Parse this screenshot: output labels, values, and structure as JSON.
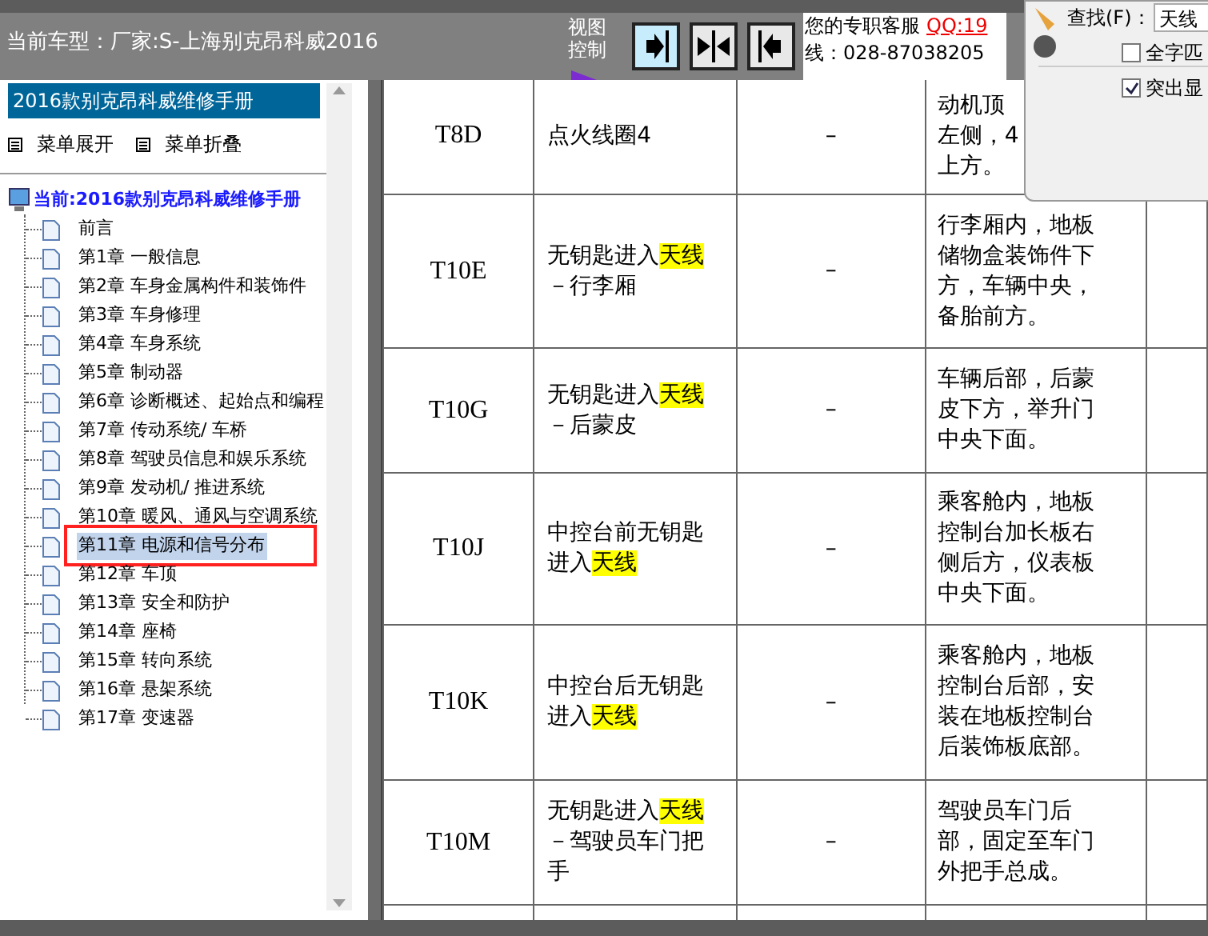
{
  "header": {
    "title": "当前车型：厂家:S-上海别克昂科威2016",
    "view_label": "视图控制",
    "view_buttons": [
      {
        "kind": "right",
        "selected": true
      },
      {
        "kind": "both",
        "selected": false
      },
      {
        "kind": "left",
        "selected": false
      }
    ],
    "service": "您的专职客服",
    "qq": "QQ:19",
    "phone": "线：028-87038205"
  },
  "find_dialog": {
    "label": "查找(F)：",
    "value": "天线",
    "options": [
      {
        "label": "全字匹",
        "checked": false
      },
      {
        "label": "突出显",
        "checked": true
      }
    ]
  },
  "sidebar": {
    "title": "2016款别克昂科威维修手册",
    "actions": [
      "菜单展开",
      "菜单折叠"
    ],
    "root": "当前:2016款别克昂科威维修手册",
    "items": [
      {
        "label": "前言",
        "selected": false,
        "marked": false
      },
      {
        "label": "第1章 一般信息",
        "selected": false,
        "marked": false
      },
      {
        "label": "第2章 车身金属构件和装饰件",
        "selected": false,
        "marked": false
      },
      {
        "label": "第3章 车身修理",
        "selected": false,
        "marked": false
      },
      {
        "label": "第4章 车身系统",
        "selected": false,
        "marked": false
      },
      {
        "label": "第5章 制动器",
        "selected": false,
        "marked": false
      },
      {
        "label": "第6章 诊断概述、起始点和编程",
        "selected": false,
        "marked": false
      },
      {
        "label": "第7章 传动系统/ 车桥",
        "selected": false,
        "marked": false
      },
      {
        "label": "第8章 驾驶员信息和娱乐系统",
        "selected": false,
        "marked": false
      },
      {
        "label": "第9章 发动机/ 推进系统",
        "selected": false,
        "marked": false
      },
      {
        "label": "第10章 暖风、通风与空调系统",
        "selected": false,
        "marked": false
      },
      {
        "label": "第11章 电源和信号分布",
        "selected": true,
        "marked": true
      },
      {
        "label": "第12章 车顶",
        "selected": false,
        "marked": false
      },
      {
        "label": "第13章 安全和防护",
        "selected": false,
        "marked": false
      },
      {
        "label": "第14章 座椅",
        "selected": false,
        "marked": false
      },
      {
        "label": "第15章 转向系统",
        "selected": false,
        "marked": false
      },
      {
        "label": "第16章 悬架系统",
        "selected": false,
        "marked": false
      },
      {
        "label": "第17章 变速器",
        "selected": false,
        "marked": false
      }
    ]
  },
  "table": {
    "rows": [
      {
        "code": "T8D",
        "name": [
          {
            "text": "点火线圈4",
            "highlight": false
          }
        ],
        "column_3": "–",
        "location": [
          "动机顶",
          "左侧，4",
          "上方。"
        ]
      },
      {
        "code": "T10E",
        "name": [
          {
            "text": "无钥匙进入",
            "highlight": false
          },
          {
            "text": "天线",
            "highlight": true
          },
          {
            "text": "－行李厢",
            "highlight": false
          }
        ],
        "column_3": "–",
        "location": [
          "行李厢内，地板储物盒装饰件下方，车辆中央，备胎前方。"
        ]
      },
      {
        "code": "T10G",
        "name": [
          {
            "text": "无钥匙进入",
            "highlight": false
          },
          {
            "text": "天线",
            "highlight": true
          },
          {
            "text": "－后蒙皮",
            "highlight": false
          }
        ],
        "column_3": "–",
        "location": [
          "车辆后部，后蒙皮下方，举升门中央下面。"
        ]
      },
      {
        "code": "T10J",
        "name": [
          {
            "text": "中控台前无钥匙进入",
            "highlight": false
          },
          {
            "text": "天线",
            "highlight": true
          }
        ],
        "column_3": "–",
        "location": [
          "乘客舱内，地板控制台加长板右侧后方，仪表板中央下面。"
        ]
      },
      {
        "code": "T10K",
        "name": [
          {
            "text": "中控台后无钥匙进入",
            "highlight": false
          },
          {
            "text": "天线",
            "highlight": true
          }
        ],
        "column_3": "–",
        "location": [
          "乘客舱内，地板控制台后部，安装在地板控制台后装饰板底部。"
        ]
      },
      {
        "code": "T10M",
        "name": [
          {
            "text": "无钥匙进入",
            "highlight": false
          },
          {
            "text": "天线",
            "highlight": true
          },
          {
            "text": "－驾驶员车门把手",
            "highlight": false
          }
        ],
        "column_3": "–",
        "location": [
          "驾驶员车门后部，固定至车门外把手总成。"
        ]
      }
    ]
  }
}
